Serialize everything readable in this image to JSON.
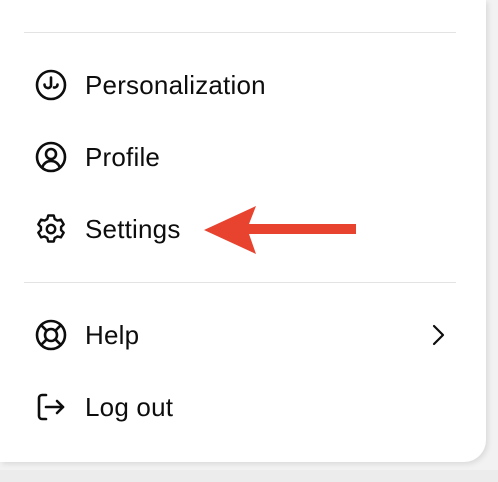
{
  "menu": {
    "items": [
      {
        "label": "Personalization",
        "icon": "personalization-icon"
      },
      {
        "label": "Profile",
        "icon": "profile-icon"
      },
      {
        "label": "Settings",
        "icon": "gear-icon"
      },
      {
        "label": "Help",
        "icon": "help-lifebuoy-icon",
        "has_submenu": true
      },
      {
        "label": "Log out",
        "icon": "logout-icon"
      }
    ]
  },
  "annotation": {
    "arrow_color": "#e8432f",
    "points_to": "Settings"
  },
  "colors": {
    "text": "#0d0d0d",
    "panel_background": "#ffffff",
    "divider": "#e3e3e3"
  }
}
